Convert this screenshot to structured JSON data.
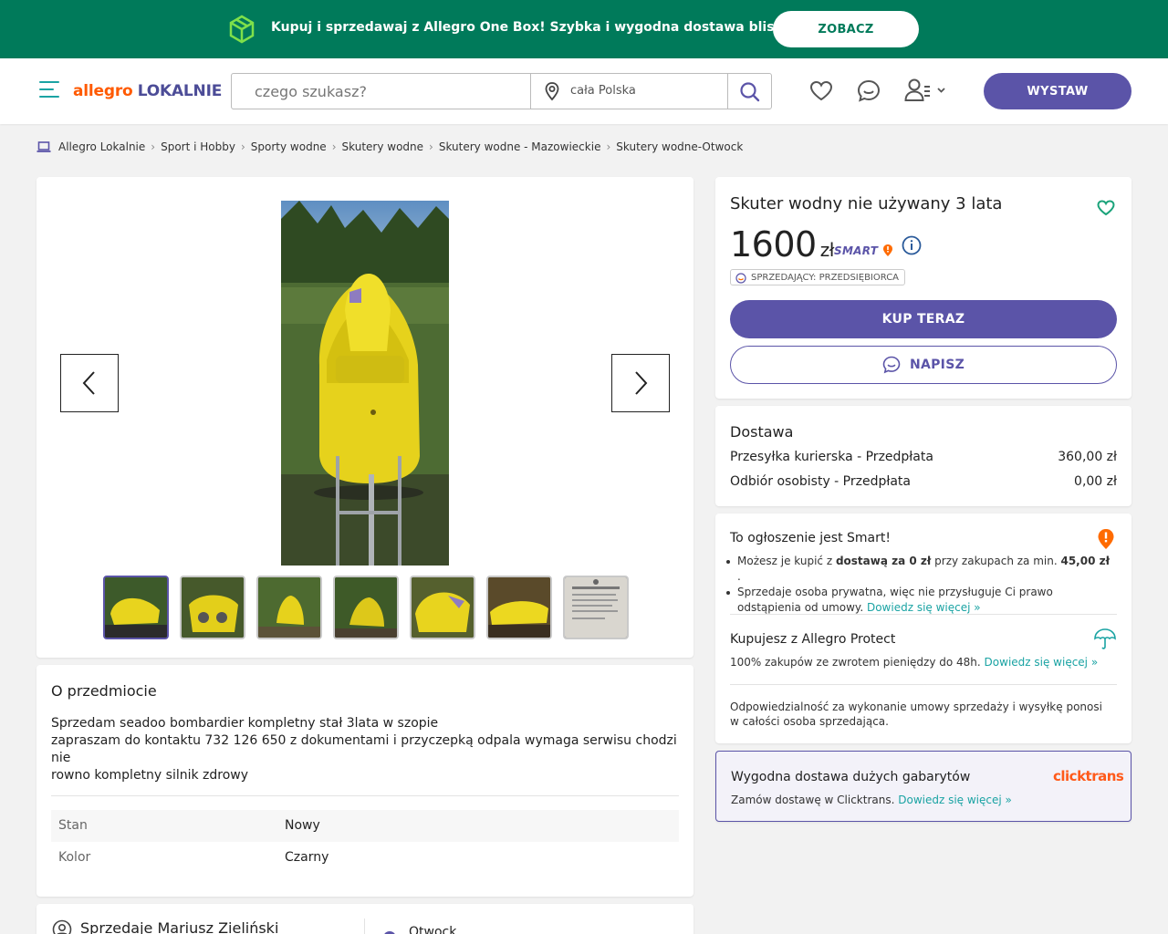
{
  "promo": {
    "text": "Kupuj i sprzedawaj z Allegro One Box! Szybka i wygodna dostawa blisko Ciebie",
    "button": "ZOBACZ"
  },
  "header": {
    "logo_allegro": "allegro",
    "logo_lokalnie": "LOKALNIE",
    "search_placeholder": "czego szukasz?",
    "location": "cała Polska",
    "publish": "WYSTAW"
  },
  "breadcrumb": [
    "Allegro Lokalnie",
    "Sport i Hobby",
    "Sporty wodne",
    "Skutery wodne",
    "Skutery wodne - Mazowieckie",
    "Skutery wodne-Otwock"
  ],
  "gallery": {
    "thumbnail_count": 7,
    "active_thumbnail": 1
  },
  "about": {
    "title": "O przedmiocie",
    "description": [
      "Sprzedam seadoo bombardier kompletny stał 3lata w szopie",
      "zapraszam do kontaktu 732 126 650 z dokumentami i przyczepką odpala wymaga serwisu chodzi nie",
      "rowno kompletny silnik zdrowy"
    ],
    "properties": [
      {
        "key": "Stan",
        "value": "Nowy"
      },
      {
        "key": "Kolor",
        "value": "Czarny"
      }
    ]
  },
  "seller": {
    "label": "Sprzedaje Mariusz Zieliński",
    "location": "Otwock"
  },
  "offer": {
    "title": "Skuter wodny nie używany 3 lata",
    "price": "1600",
    "currency": "zł",
    "smart_badge": "SMART",
    "seller_type": "SPRZEDAJĄCY: PRZEDSIĘBIORCA",
    "buy_now": "KUP TERAZ",
    "message": "NAPISZ"
  },
  "shipping": {
    "title": "Dostawa",
    "options": [
      {
        "name": "Przesyłka kurierska - Przedpłata",
        "price": "360,00 zł"
      },
      {
        "name": "Odbiór osobisty - Przedpłata",
        "price": "0,00 zł"
      }
    ]
  },
  "smart": {
    "title": "To ogłoszenie jest Smart!",
    "line1_pre": "Możesz je kupić z ",
    "line1_bold": "dostawą za 0 zł",
    "line1_mid": " przy zakupach za min. ",
    "line1_amount": "45,00 zł",
    "line1_end": " .",
    "line2": "Sprzedaje osoba prywatna, więc nie przysługuje Ci prawo odstąpienia od umowy.",
    "line2_link": "Dowiedz się więcej »",
    "protect_title": "Kupujesz z Allegro Protect",
    "protect_text": "100% zakupów ze zwrotem pieniędzy do 48h.",
    "protect_link": "Dowiedz się więcej »",
    "responsibility": "Odpowiedzialność za wykonanie umowy sprzedaży i wysyłkę ponosi w całości osoba sprzedająca."
  },
  "clicktrans": {
    "title": "Wygodna dostawa dużych gabarytów",
    "logo": "clicktrans",
    "text": "Zamów dostawę w Clicktrans.",
    "link": "Dowiedz się więcej »"
  },
  "colors": {
    "brand_purple": "#5b54a8",
    "promo_green": "#007a5a",
    "allegro_orange": "#ff5a00",
    "link_teal": "#1aa3a3"
  }
}
